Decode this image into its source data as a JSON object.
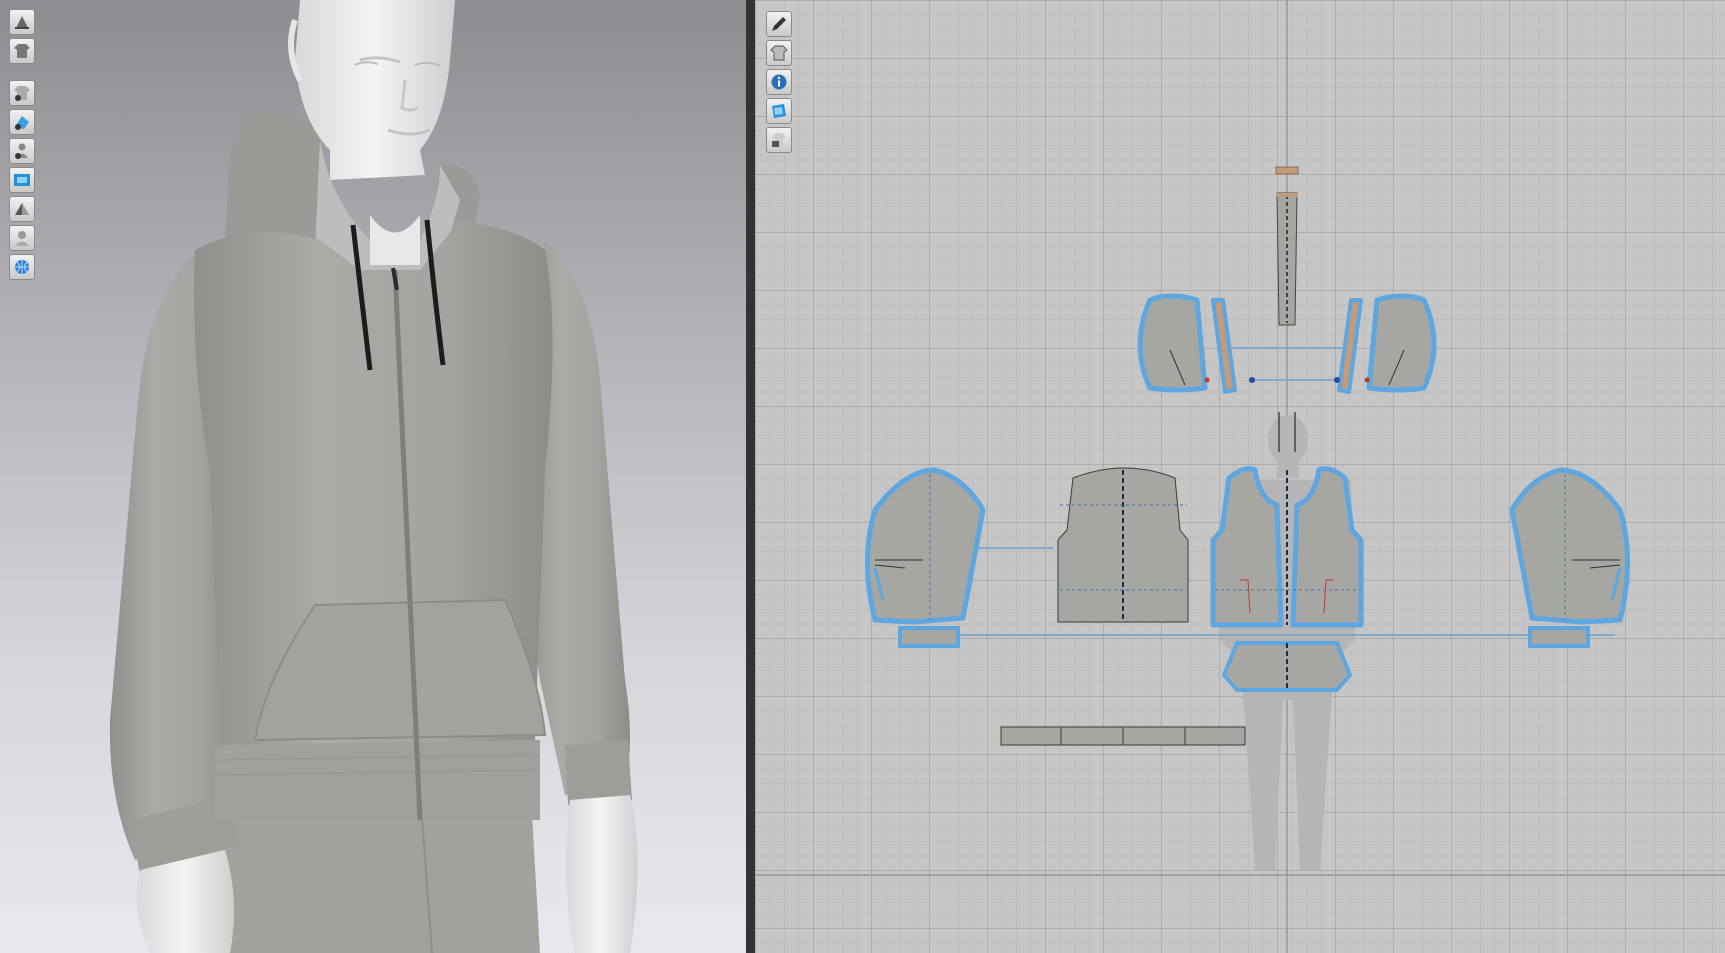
{
  "viewport_3d": {
    "toolbar": [
      {
        "icon": "display-avatar-icon"
      },
      {
        "icon": "display-garment-icon"
      },
      {
        "icon": "show-garment-icon"
      },
      {
        "icon": "show-pattern-icon"
      },
      {
        "icon": "show-avatar-icon"
      },
      {
        "icon": "texture-mode-icon"
      },
      {
        "icon": "surface-mode-icon"
      },
      {
        "icon": "avatar-skin-icon"
      },
      {
        "icon": "global-mesh-icon"
      }
    ]
  },
  "viewport_2d": {
    "toolbar": [
      {
        "icon": "pencil-tool-icon"
      },
      {
        "icon": "garment-shirt-icon"
      },
      {
        "icon": "info-icon"
      },
      {
        "icon": "fabric-display-icon"
      },
      {
        "icon": "lock-pattern-icon"
      }
    ]
  },
  "colors": {
    "garment_fill": "#a9aaa6",
    "pattern_outline": "#5ea6e0",
    "pattern_fill": "#a6a7a2",
    "grid_background": "#c6c6c6",
    "drawstring": "#1c1c1c"
  }
}
